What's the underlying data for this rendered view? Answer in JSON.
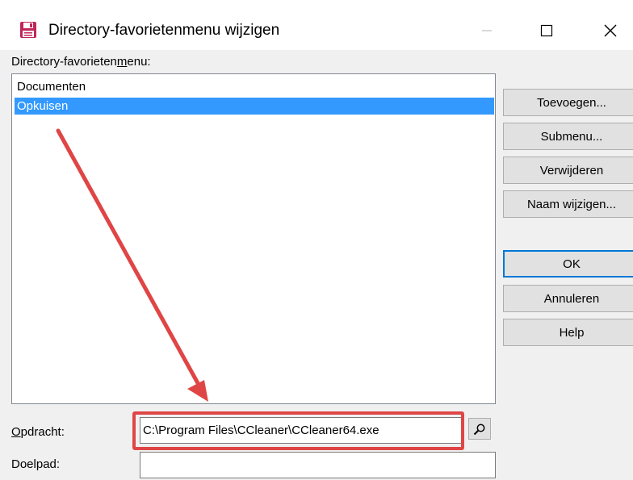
{
  "window": {
    "title": "Directory-favorietenmenu wijzigen",
    "icon": "floppy-disk-icon",
    "controls": [
      "minimize-icon",
      "maximize-icon",
      "close-icon"
    ]
  },
  "list_label": {
    "prefix": "Directory-favorieten",
    "mnemonic": "m",
    "suffix": "enu:"
  },
  "list": {
    "items": [
      "Documenten",
      "Opkuisen"
    ],
    "selected": "Opkuisen"
  },
  "buttons": {
    "add": "Toevoegen...",
    "submenu": "Submenu...",
    "delete": "Verwijderen",
    "rename": "Naam wijzigen...",
    "ok": "OK",
    "cancel": "Annuleren",
    "help": "Help"
  },
  "command": {
    "mnemonic": "O",
    "label_rest": "pdracht:",
    "value": "C:\\Program Files\\CCleaner\\CCleaner64.exe",
    "browse_icon": "magnifier-icon"
  },
  "target_path": {
    "label": "Doelpad:",
    "value": ""
  },
  "annotation": {
    "color": "#e04545"
  }
}
